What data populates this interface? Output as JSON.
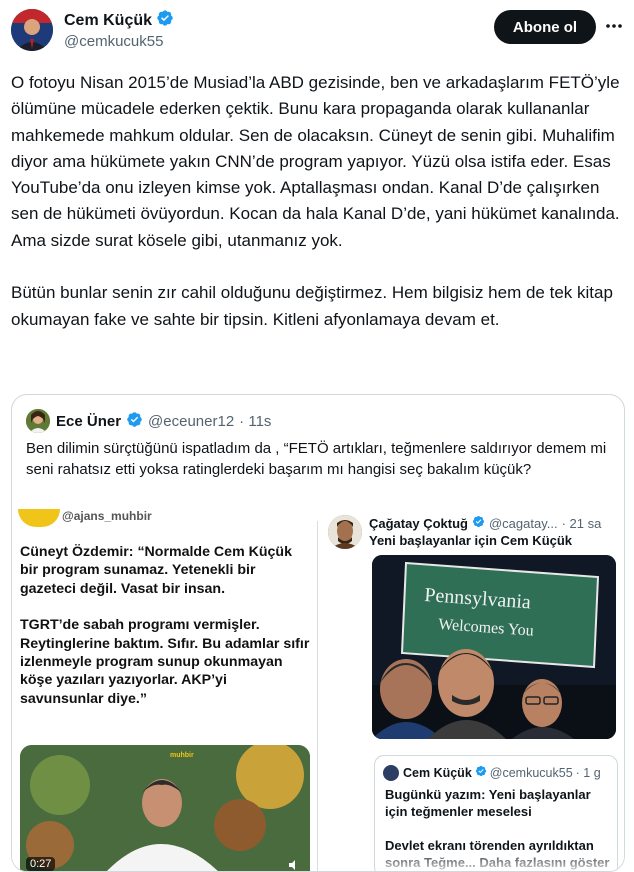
{
  "author": {
    "name": "Cem Küçük",
    "handle": "@cemkucuk55"
  },
  "actions": {
    "follow_label": "Abone ol",
    "more_icon": "more-icon"
  },
  "tweet": {
    "text": "O fotoyu Nisan 2015’de Musiad’la ABD gezisinde, ben ve arkadaşlarım FETÖ’yle ölümüne mücadele ederken çektik. Bunu kara propaganda olarak kullananlar mahkemede mahkum oldular. Sen de olacaksın. Cüneyt de senin gibi. Muhalifim diyor ama hükümete yakın CNN’de program yapıyor. Yüzü olsa istifa eder. Esas YouTube’da onu izleyen kimse yok. Aptallaşması ondan. Kanal D’de çalışırken sen de hükümeti övüyordun. Kocan da hala Kanal D’de, yani hükümet kanalında. Ama sizde surat kösele gibi, utanmanız yok.\n\nBütün bunlar senin zır cahil olduğunu değiştirmez. Hem bilgisiz hem de tek kitap okumayan fake ve sahte bir tipsin. Kitleni afyonlamaya devam et."
  },
  "quoted": {
    "name": "Ece Üner",
    "handle": "@eceuner12",
    "time": "· 11s",
    "text": "Ben dilimin sürçtüğünü ispatladım da , “FETÖ artıkları, teğmenlere saldırıyor demem mi seni rahatsız etti yoksa ratinglerdeki başarım mı hangisi seç bakalım küçük?",
    "media_left": {
      "source_handle": "@ajans_muhbir",
      "quote_p1": "Cüneyt Özdemir: “Normalde Cem Küçük bir program sunamaz. Yetenekli bir gazeteci değil. Vasat bir insan.",
      "quote_p2": "TGRT’de sabah programı vermişler. Reytinglerine baktım. Sıfır. Bu adamlar sıfır izlenmeyle program sunup okunmayan köşe yazıları yazıyorlar. AKP’yi savunsunlar diye.”",
      "video_time": "0:27",
      "video_watermark": "muhbir"
    },
    "media_right": {
      "name": "Çağatay Çoktuğ",
      "handle": "@cagatay...",
      "time": "· 21 sa",
      "text": "Yeni başlayanlar için Cem Küçük",
      "sign_line1": "Pennsylvania",
      "sign_line2": "Welcomes You",
      "inner_quote": {
        "name": "Cem Küçük",
        "handle": "@cemkucuk55",
        "time": "· 1 g",
        "text_p1": "Bugünkü yazım: Yeni başlayanlar için teğmenler meselesi",
        "text_p2": "Devlet ekranı törenden ayrıldıktan sonra Teğme... Daha fazlasını göster"
      }
    }
  },
  "colors": {
    "verified": "#1d9bf0",
    "follow_bg": "#0f1419",
    "secondary_text": "#536471",
    "border": "#cfd9de"
  }
}
